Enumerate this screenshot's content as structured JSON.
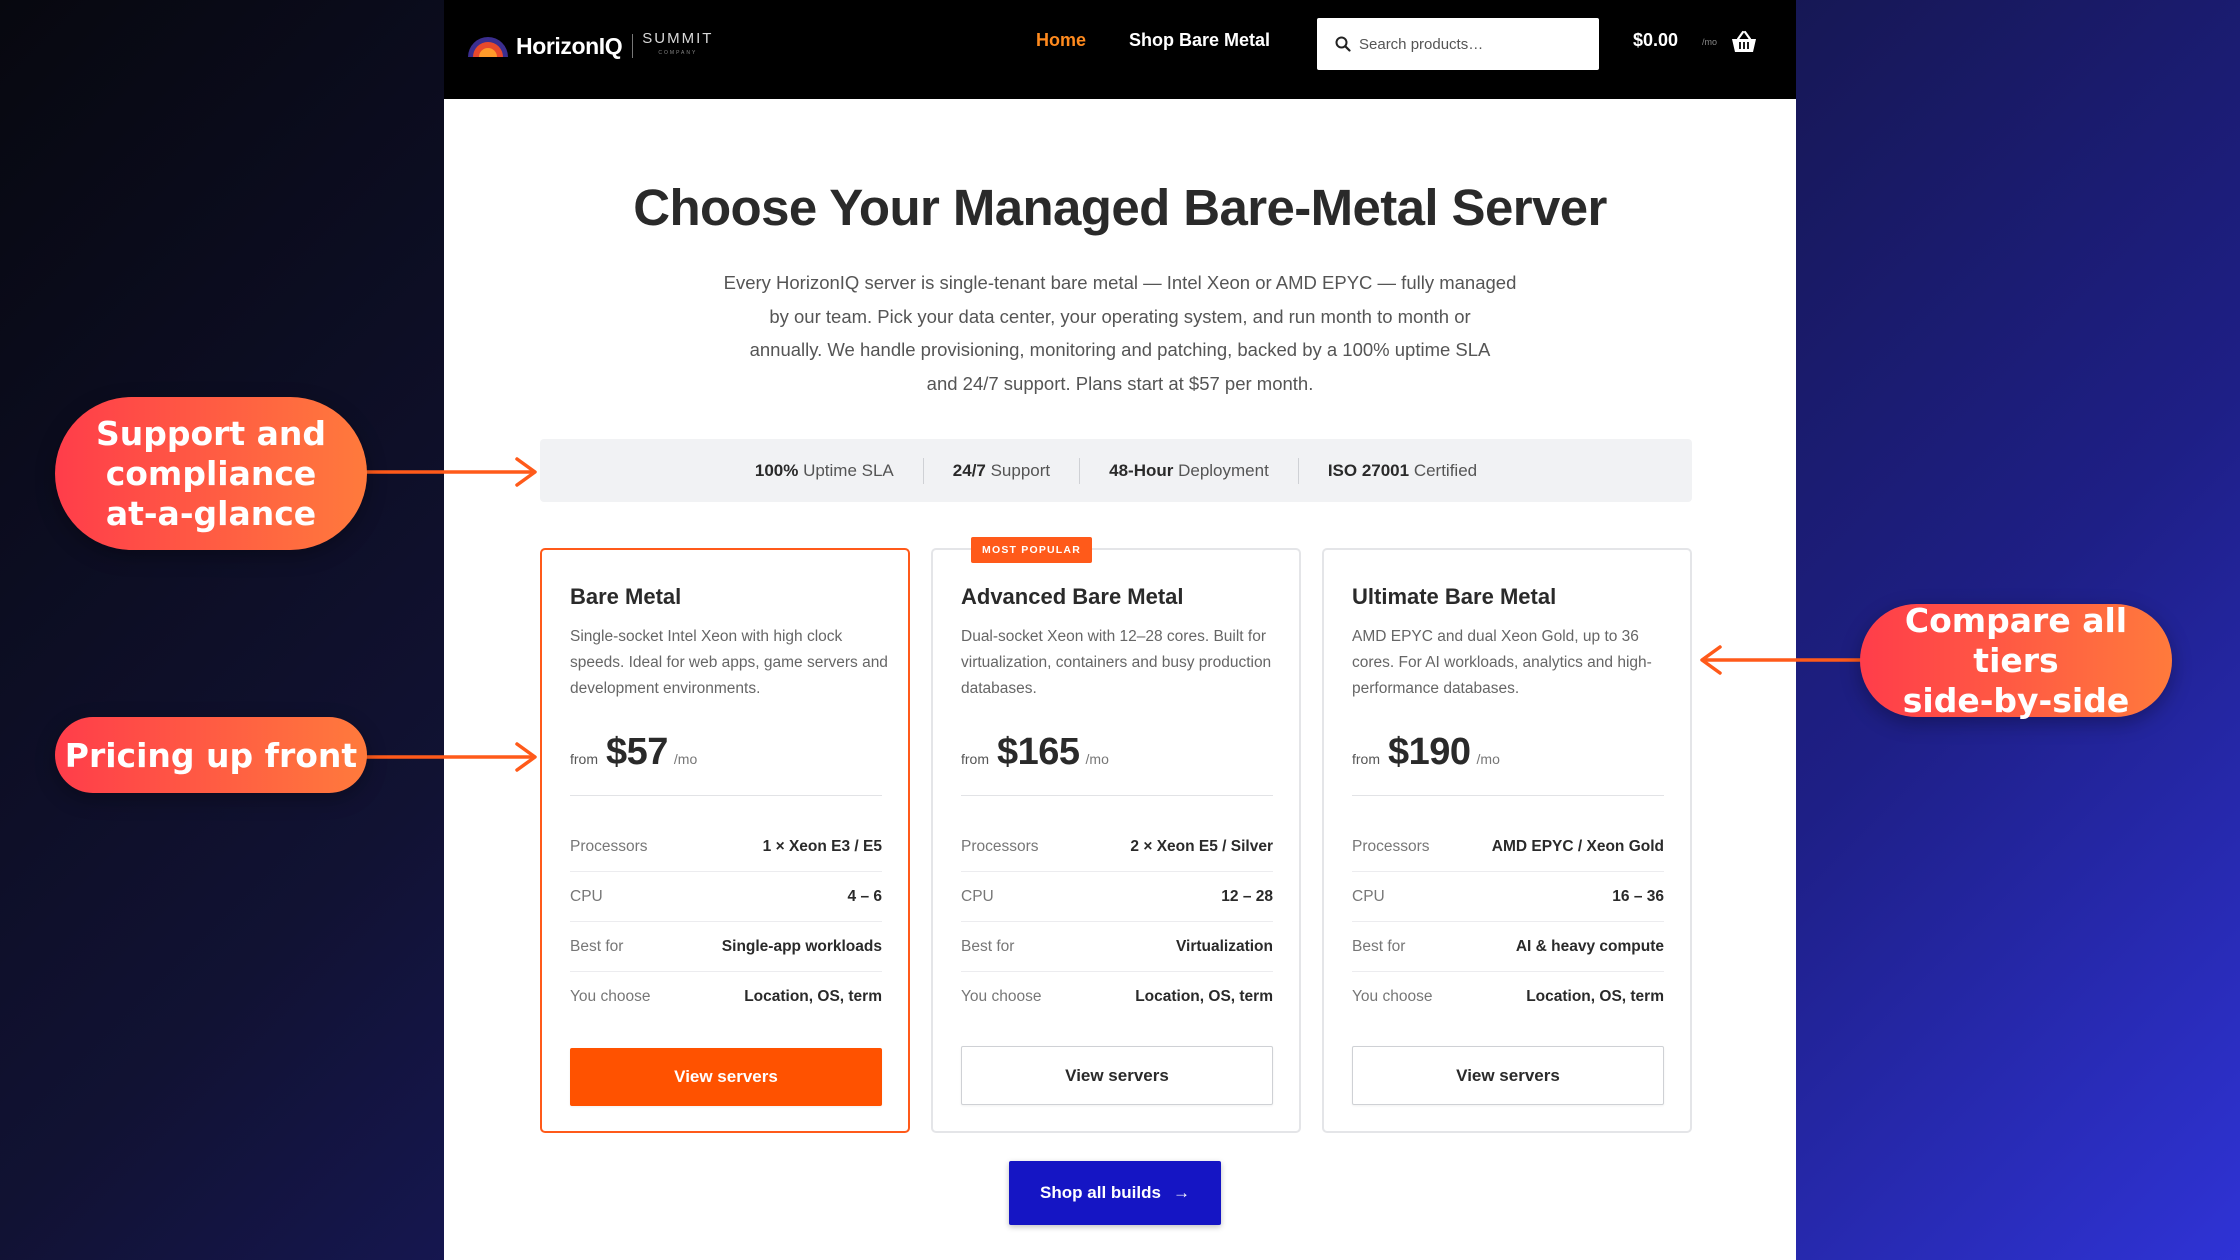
{
  "header": {
    "logo_text": "HorizonIQ",
    "logo_partner": "SUMMIT",
    "logo_partner_sub": "COMPANY",
    "nav": [
      {
        "label": "Home",
        "active": true
      },
      {
        "label": "Shop Bare Metal",
        "active": false
      }
    ],
    "search_placeholder": "Search products…",
    "cart_total": "$0.00",
    "cart_period": "/mo",
    "accent_color": "#ff8a1e"
  },
  "hero": {
    "title": "Choose Your Managed Bare-Metal Server",
    "lede_lines": [
      "Every HorizonIQ server is single-tenant bare metal — Intel Xeon or AMD EPYC — fully managed",
      "by our team. Pick your data center, your operating system, and run month to month or",
      "annually. We handle provisioning, monitoring and patching, backed by a 100% uptime SLA",
      "and 24/7 support. Plans start at $57 per month."
    ]
  },
  "stats": [
    {
      "bold": "100%",
      "text": " Uptime SLA"
    },
    {
      "bold": "24/7",
      "text": " Support"
    },
    {
      "bold": "48-Hour",
      "text": " Deployment"
    },
    {
      "bold": "ISO 27001",
      "text": " Certified"
    }
  ],
  "plans": [
    {
      "name": "Bare Metal",
      "badge": "",
      "featured": true,
      "desc": "Single-socket Intel Xeon with high clock speeds. Ideal for web apps, game servers and development environments.",
      "price_from": "from",
      "price": "$57",
      "price_period": "/mo",
      "specs": [
        {
          "key": "Processors",
          "value": "1 × Xeon E3 / E5"
        },
        {
          "key": "CPU",
          "value": "4 – 6"
        },
        {
          "key": "Best for",
          "value": "Single-app workloads"
        },
        {
          "key": "You choose",
          "value": "Location, OS, term"
        }
      ],
      "cta": "View servers"
    },
    {
      "name": "Advanced Bare Metal",
      "badge": "MOST POPULAR",
      "featured": false,
      "desc": "Dual-socket Xeon with 12–28 cores. Built for virtualization, containers and busy production databases.",
      "price_from": "from",
      "price": "$165",
      "price_period": "/mo",
      "specs": [
        {
          "key": "Processors",
          "value": "2 × Xeon E5 / Silver"
        },
        {
          "key": "CPU",
          "value": "12 – 28"
        },
        {
          "key": "Best for",
          "value": "Virtualization"
        },
        {
          "key": "You choose",
          "value": "Location, OS, term"
        }
      ],
      "cta": "View servers"
    },
    {
      "name": "Ultimate Bare Metal",
      "badge": "",
      "featured": false,
      "desc": "AMD EPYC and dual Xeon Gold, up to 36 cores. For AI workloads, analytics and high-performance databases.",
      "price_from": "from",
      "price": "$190",
      "price_period": "/mo",
      "specs": [
        {
          "key": "Processors",
          "value": "AMD EPYC / Xeon Gold"
        },
        {
          "key": "CPU",
          "value": "16 – 36"
        },
        {
          "key": "Best for",
          "value": "AI & heavy compute"
        },
        {
          "key": "You choose",
          "value": "Location, OS, term"
        }
      ],
      "cta": "View servers"
    }
  ],
  "shop_all": {
    "label": "Shop all builds",
    "arrow": "→"
  },
  "callouts": {
    "support": [
      "Support and",
      "compliance",
      "at-a-glance"
    ],
    "pricing": "Pricing up front",
    "compare": [
      "Compare all tiers",
      "side-by-side"
    ]
  },
  "colors": {
    "brand_orange": "#ff5200",
    "brand_blue": "#1515c4",
    "annotation_gradient_start": "#ff3d4a",
    "annotation_gradient_end": "#ff7a3c"
  }
}
